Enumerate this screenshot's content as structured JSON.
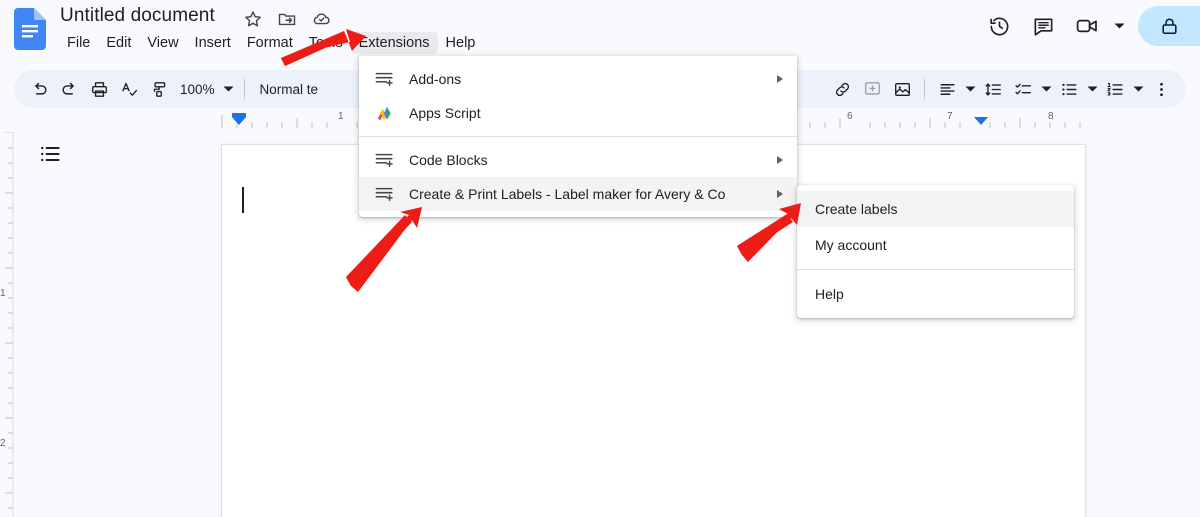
{
  "app": {
    "name": "Google Docs",
    "logo_icon": "docs-logo-icon"
  },
  "header": {
    "document_title": "Untitled document",
    "title_icons": [
      {
        "name": "star-icon",
        "label": "Star"
      },
      {
        "name": "move-to-folder-icon",
        "label": "Move"
      },
      {
        "name": "cloud-saved-icon",
        "label": "Saved to Drive"
      }
    ],
    "menus": [
      {
        "label": "File",
        "active": false
      },
      {
        "label": "Edit",
        "active": false
      },
      {
        "label": "View",
        "active": false
      },
      {
        "label": "Insert",
        "active": false
      },
      {
        "label": "Format",
        "active": false
      },
      {
        "label": "Tools",
        "active": false
      },
      {
        "label": "Extensions",
        "active": true
      },
      {
        "label": "Help",
        "active": false
      }
    ],
    "right_actions": [
      {
        "name": "version-history-icon",
        "label": "Last edit"
      },
      {
        "name": "comment-icon",
        "label": "Open comment history"
      },
      {
        "name": "meet-camera-icon",
        "label": "Join a call"
      },
      {
        "name": "meet-caret-icon",
        "label": "Meet options"
      },
      {
        "name": "lock-icon",
        "label": "Private"
      }
    ]
  },
  "toolbar": {
    "undo_label": "Undo",
    "redo_label": "Redo",
    "print_label": "Print",
    "spelling_label": "Spelling and grammar check",
    "paint_format_label": "Paint format",
    "zoom_value": "100%",
    "zoom_caret": "▾",
    "style_value": "Normal te",
    "style_caret": "▾",
    "items": [
      {
        "name": "insert-link-icon",
        "label": "Insert link"
      },
      {
        "name": "add-comment-icon",
        "label": "Add comment"
      },
      {
        "name": "insert-image-icon",
        "label": "Insert image"
      },
      {
        "name": "align-icon",
        "label": "Align"
      },
      {
        "name": "line-spacing-icon",
        "label": "Line & paragraph spacing"
      },
      {
        "name": "checklist-icon",
        "label": "Checklist"
      },
      {
        "name": "bulleted-list-icon",
        "label": "Bulleted list"
      },
      {
        "name": "numbered-list-icon",
        "label": "Numbered list"
      },
      {
        "name": "more-options-icon",
        "label": "More"
      }
    ]
  },
  "ruler": {
    "horizontal_numbers": [
      "1",
      "6",
      "7",
      "8"
    ],
    "vertical_numbers": [
      "1",
      "2"
    ]
  },
  "document": {
    "outline_icon": "document-outline-icon",
    "body_text": "",
    "caret_visible": true
  },
  "extensions_menu": {
    "items": [
      {
        "label": "Add-ons",
        "icon": "addon-icon",
        "submenu": true,
        "highlighted": false
      },
      {
        "label": "Apps Script",
        "icon": "apps-script-icon",
        "submenu": false,
        "highlighted": false
      },
      {
        "separator": true
      },
      {
        "label": "Code Blocks",
        "icon": "addon-icon",
        "submenu": true,
        "highlighted": false
      },
      {
        "label": "Create & Print Labels - Label maker for Avery & Co",
        "icon": "addon-icon",
        "submenu": true,
        "highlighted": true
      }
    ]
  },
  "labels_submenu": {
    "items": [
      {
        "label": "Create labels",
        "highlighted": true
      },
      {
        "label": "My account",
        "highlighted": false
      },
      {
        "separator": true
      },
      {
        "label": "Help",
        "highlighted": false
      }
    ]
  },
  "annotations": {
    "arrow_color": "#ee1c16",
    "arrows": [
      {
        "name": "arrow-to-extensions-menu",
        "points_to": "Extensions"
      },
      {
        "name": "arrow-to-create-print-labels",
        "points_to": "Create & Print Labels - Label maker for Avery & Co"
      },
      {
        "name": "arrow-to-create-labels",
        "points_to": "Create labels"
      }
    ]
  }
}
